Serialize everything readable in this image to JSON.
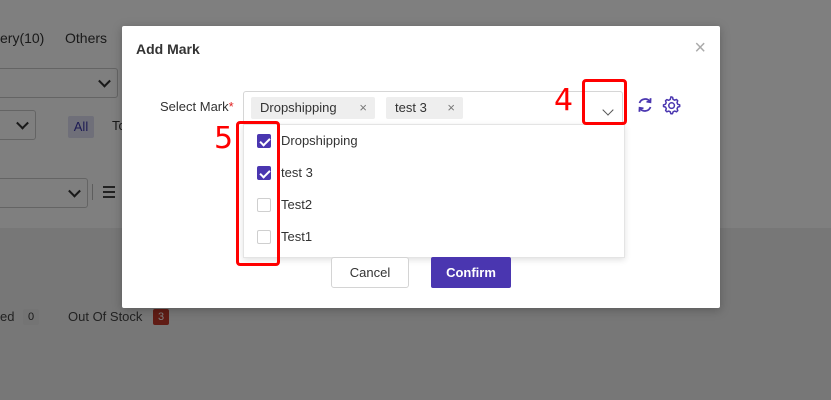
{
  "background": {
    "tabs": [
      {
        "label": "ery(10)"
      },
      {
        "label": "Others"
      }
    ],
    "filter_all_label": "All",
    "filter_next_label": "Tc",
    "status_items": [
      {
        "label": "ed",
        "count": "0",
        "badge_bg": "#e8e8e8",
        "badge_fg": "#333333"
      },
      {
        "label": "Out Of Stock",
        "count": "3",
        "badge_bg": "#c0392b",
        "badge_fg": "#ffffff"
      }
    ]
  },
  "modal": {
    "title": "Add Mark",
    "close_symbol": "×",
    "field_label": "Select Mark",
    "required_marker": "*",
    "selected_tags": [
      {
        "label": "Dropshipping",
        "remove_symbol": "×"
      },
      {
        "label": "test 3",
        "remove_symbol": "×"
      }
    ],
    "options": [
      {
        "label": "Dropshipping",
        "checked": true
      },
      {
        "label": "test 3",
        "checked": true
      },
      {
        "label": "Test2",
        "checked": false
      },
      {
        "label": "Test1",
        "checked": false
      }
    ],
    "cancel_label": "Cancel",
    "confirm_label": "Confirm",
    "icons": {
      "refresh": "refresh-icon",
      "settings": "gear-icon",
      "dropdown": "chevron-down-icon"
    }
  },
  "annotations": {
    "dropdown_step": "4",
    "checkbox_step": "5"
  },
  "colors": {
    "accent": "#4a36b0",
    "annotation": "#ff0000",
    "required": "#e02020"
  }
}
